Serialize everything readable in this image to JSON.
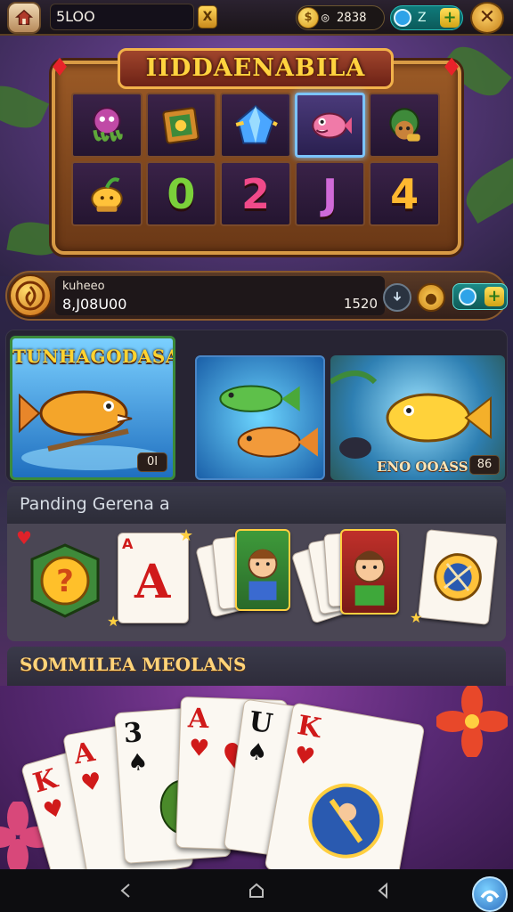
{
  "topbar": {
    "balance_label": "5LOO",
    "gold_badge": "X",
    "coins": "2838",
    "coin_icon_glyph": "◎",
    "gems": "Z",
    "close_glyph": "✕"
  },
  "slot": {
    "title": "IIDDAENABILA",
    "reel_letters": [
      "0",
      "2",
      "J",
      "4"
    ],
    "accent": "#ffd33f"
  },
  "info": {
    "name": "kuheeo",
    "amount": "8,J08U00",
    "right_value": "1520"
  },
  "featured": {
    "card1_title": "TUNHAGODASA",
    "card1_badge": "0I",
    "card3_label": "ENO OOASS",
    "card3_badge": "86"
  },
  "sections": {
    "pending_title": "Panding Gerena a",
    "special_title": "SOMMILEA MEOLANS"
  },
  "bottom_cards": [
    "K",
    "A",
    "3",
    "A",
    "U",
    "K"
  ]
}
